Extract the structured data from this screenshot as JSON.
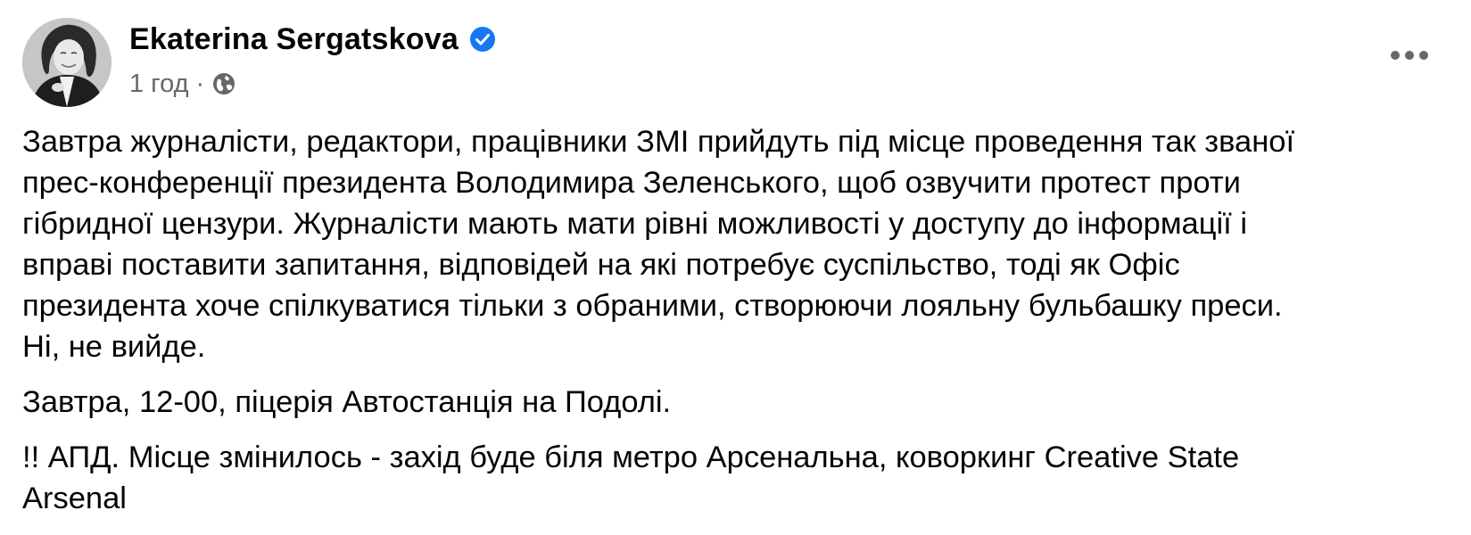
{
  "post": {
    "author": {
      "name": "Ekaterina Sergatskova",
      "verified_icon": "verified-badge-icon",
      "avatar_icon": "avatar-photo"
    },
    "meta": {
      "time": "1 год",
      "separator": "·",
      "privacy_icon": "globe-icon"
    },
    "menu_icon": "more-options-icon",
    "colors": {
      "text_primary": "#050505",
      "text_secondary": "#65676b",
      "verified_blue": "#1877f2"
    },
    "paragraphs": [
      {
        "lines": [
          "Завтра журналісти, редактори, працівники ЗМІ прийдуть під місце проведення так званої",
          "прес-конференції президента Володимира Зеленського, щоб озвучити протест проти",
          "гібридної цензури. Журналісти мають мати рівні можливості у доступу до інформації і",
          "вправі поставити запитання, відповідей на які потребує суспільство, тоді як Офіс",
          "президента хоче спілкуватися тільки з обраними, створюючи лояльну бульбашку преси.",
          "Ні, не вийде."
        ]
      },
      {
        "lines": [
          "Завтра, 12-00, піцерія Автостанція на Подолі."
        ]
      },
      {
        "lines": [
          "!! АПД. Місце змінилось - захід буде біля метро Арсенальна, коворкинг Creative State",
          "Arsenal"
        ]
      }
    ]
  }
}
